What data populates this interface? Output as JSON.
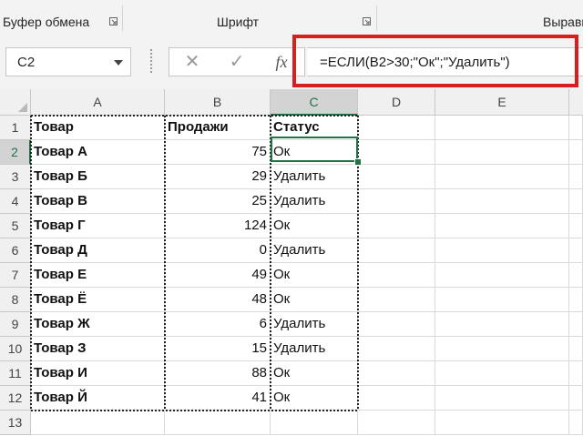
{
  "ribbon": {
    "groups": [
      "Буфер обмена",
      "Шрифт",
      "Выравнивание"
    ]
  },
  "formula_bar": {
    "name_box": "C2",
    "cancel_label": "✕",
    "enter_label": "✓",
    "fx_label": "fx",
    "formula": "=ЕСЛИ(B2>30;\"Ок\";\"Удалить\")"
  },
  "grid": {
    "columns": [
      "A",
      "B",
      "C",
      "D",
      "E"
    ],
    "rows": [
      {
        "num": "1",
        "a": "Товар",
        "b": "Продажи",
        "c": "Статус"
      },
      {
        "num": "2",
        "a": "Товар А",
        "b": "75",
        "c": "Ок"
      },
      {
        "num": "3",
        "a": "Товар Б",
        "b": "29",
        "c": "Удалить"
      },
      {
        "num": "4",
        "a": "Товар В",
        "b": "25",
        "c": "Удалить"
      },
      {
        "num": "5",
        "a": "Товар Г",
        "b": "124",
        "c": "Ок"
      },
      {
        "num": "6",
        "a": "Товар Д",
        "b": "0",
        "c": "Удалить"
      },
      {
        "num": "7",
        "a": "Товар Е",
        "b": "49",
        "c": "Ок"
      },
      {
        "num": "8",
        "a": "Товар Ё",
        "b": "48",
        "c": "Ок"
      },
      {
        "num": "9",
        "a": "Товар Ж",
        "b": "6",
        "c": "Удалить"
      },
      {
        "num": "10",
        "a": "Товар З",
        "b": "15",
        "c": "Удалить"
      },
      {
        "num": "11",
        "a": "Товар И",
        "b": "88",
        "c": "Ок"
      },
      {
        "num": "12",
        "a": "Товар Й",
        "b": "41",
        "c": "Ок"
      },
      {
        "num": "13",
        "a": "",
        "b": "",
        "c": ""
      }
    ]
  },
  "colors": {
    "accent": "#217346",
    "highlight": "#d81e1e"
  }
}
